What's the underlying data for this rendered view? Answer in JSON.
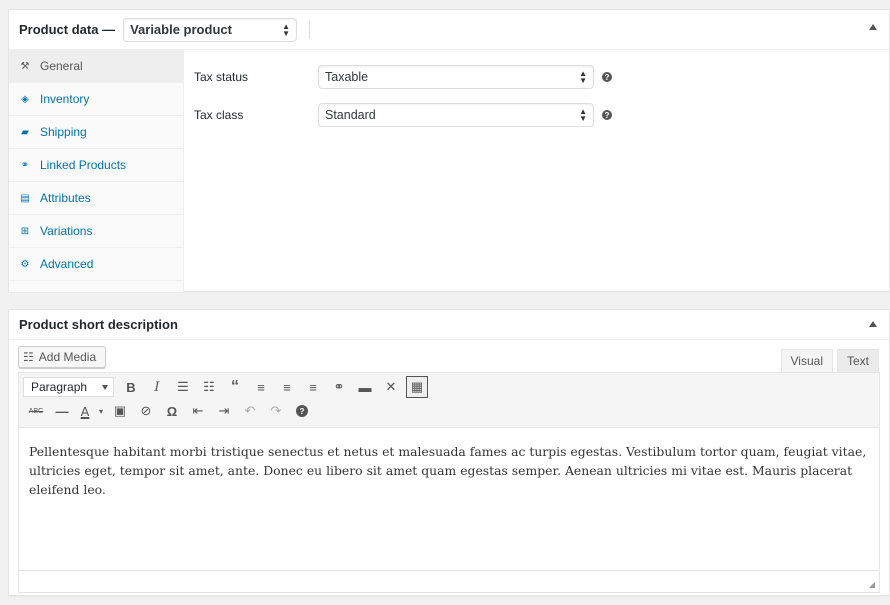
{
  "product_data": {
    "title": "Product Data —",
    "title_display": "Product data —",
    "type_select": "Variable product",
    "tabs": [
      {
        "label": "General",
        "icon": "wrench-icon",
        "glyph": "🔧",
        "active": true
      },
      {
        "label": "Inventory",
        "icon": "tag-icon",
        "glyph": "◈"
      },
      {
        "label": "Shipping",
        "icon": "truck-icon",
        "glyph": "▰"
      },
      {
        "label": "Linked Products",
        "icon": "link-icon",
        "glyph": "⚭"
      },
      {
        "label": "Attributes",
        "icon": "list-card-icon",
        "glyph": "▤"
      },
      {
        "label": "Variations",
        "icon": "grid-icon",
        "glyph": "⊞"
      },
      {
        "label": "Advanced",
        "icon": "gear-icon",
        "glyph": "⚙"
      }
    ],
    "fields": [
      {
        "label": "Tax status",
        "value": "Taxable"
      },
      {
        "label": "Tax class",
        "value": "Standard"
      }
    ]
  },
  "short_description": {
    "title": "Product short description",
    "add_media_label": "Add Media",
    "mode_tabs": {
      "visual": "Visual",
      "text": "Text"
    },
    "format_select": "Paragraph",
    "toolbar_row1": [
      {
        "name": "bold-icon",
        "glyph": "B"
      },
      {
        "name": "italic-icon",
        "glyph": "I"
      },
      {
        "name": "bullet-list-icon",
        "glyph": "☰"
      },
      {
        "name": "numbered-list-icon",
        "glyph": "☷"
      },
      {
        "name": "blockquote-icon",
        "glyph": "❝"
      },
      {
        "name": "align-left-icon",
        "glyph": "≡"
      },
      {
        "name": "align-center-icon",
        "glyph": "≡"
      },
      {
        "name": "align-right-icon",
        "glyph": "≡"
      },
      {
        "name": "link-icon",
        "glyph": "🔗"
      },
      {
        "name": "read-more-icon",
        "glyph": "▬"
      },
      {
        "name": "fullscreen-icon",
        "glyph": "⤧"
      },
      {
        "name": "toolbar-toggle-icon",
        "glyph": "▦"
      }
    ],
    "toolbar_row2": [
      {
        "name": "strikethrough-icon",
        "glyph": "ABC"
      },
      {
        "name": "horizontal-line-icon",
        "glyph": "—"
      },
      {
        "name": "text-color-icon",
        "glyph": "A"
      },
      {
        "name": "text-color-dropdown-icon",
        "glyph": "▾"
      },
      {
        "name": "paste-text-icon",
        "glyph": "📋"
      },
      {
        "name": "clear-formatting-icon",
        "glyph": "⌫"
      },
      {
        "name": "special-character-icon",
        "glyph": "Ω"
      },
      {
        "name": "outdent-icon",
        "glyph": "⇤"
      },
      {
        "name": "indent-icon",
        "glyph": "⇥"
      },
      {
        "name": "undo-icon",
        "glyph": "↶"
      },
      {
        "name": "redo-icon",
        "glyph": "↷"
      },
      {
        "name": "help-icon",
        "glyph": "?"
      }
    ],
    "content": "Pellentesque habitant morbi tristique senectus et netus et malesuada fames ac turpis egestas. Vestibulum tortor quam, feugiat vitae, ultricies eget, tempor sit amet, ante. Donec eu libero sit amet quam egestas semper. Aenean ultricies mi vitae est. Mauris placerat eleifend leo."
  }
}
